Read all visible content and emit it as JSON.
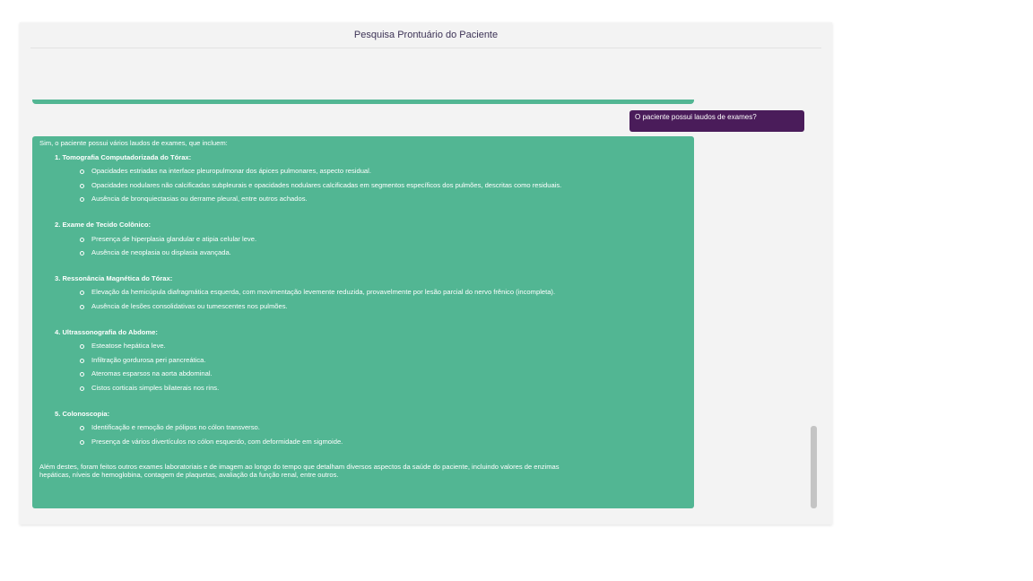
{
  "window": {
    "title": "Pesquisa Prontuário do Paciente"
  },
  "chat": {
    "user_message": "O paciente possui laudos de exames?",
    "assistant": {
      "intro": "Sim, o paciente possui vários laudos de exames, que incluem:",
      "sections": [
        {
          "title": "1. Tomografia Computadorizada do Tórax:",
          "items": [
            "Opacidades estriadas na interface pleuropulmonar dos ápices pulmonares, aspecto residual.",
            "Opacidades nodulares não calcificadas subpleurais e opacidades nodulares calcificadas em segmentos específicos dos pulmões, descritas como residuais.",
            "Ausência de bronquiectasias ou derrame pleural, entre outros achados."
          ]
        },
        {
          "title": "2. Exame de Tecido Colônico:",
          "items": [
            "Presença de hiperplasia glandular e atipia celular leve.",
            "Ausência de neoplasia ou displasia avançada."
          ]
        },
        {
          "title": "3. Ressonância Magnética do Tórax:",
          "items": [
            "Elevação da hemicúpula diafragmática esquerda, com movimentação levemente reduzida, provavelmente por lesão parcial do nervo frênico (incompleta).",
            "Ausência de lesões consolidativas ou tumescentes nos pulmões."
          ]
        },
        {
          "title": "4. Ultrassonografia do Abdome:",
          "items": [
            "Esteatose hepática leve.",
            "Infiltração gordurosa peri pancreática.",
            "Ateromas esparsos na aorta abdominal.",
            "Cistos corticais simples bilaterais nos rins."
          ]
        },
        {
          "title": "5. Colonoscopia:",
          "items": [
            "Identificação e remoção de pólipos no cólon transverso.",
            "Presença de vários divertículos no cólon esquerdo, com deformidade em sigmoide."
          ]
        }
      ],
      "outro": "Além destes, foram feitos outros exames laboratoriais e de imagem ao longo do tempo que detalham diversos aspectos da saúde do paciente, incluindo valores de enzimas hepáticas, níveis de hemoglobina, contagem de plaquetas, avaliação da função renal, entre outros."
    }
  },
  "colors": {
    "assistant_bubble": "#52b693",
    "user_bubble": "#4a1c5a",
    "panel": "#f3f3f3"
  }
}
